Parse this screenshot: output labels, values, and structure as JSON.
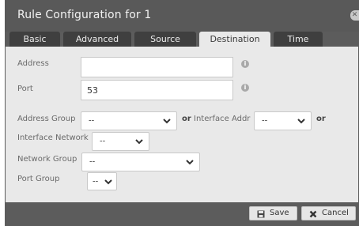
{
  "dialog": {
    "title": "Rule Configuration for 1",
    "close_icon": "close-icon"
  },
  "tabs": [
    {
      "label": "Basic",
      "active": false
    },
    {
      "label": "Advanced",
      "active": false
    },
    {
      "label": "Source",
      "active": false
    },
    {
      "label": "Destination",
      "active": true
    },
    {
      "label": "Time",
      "active": false
    }
  ],
  "form": {
    "address": {
      "label": "Address",
      "value": ""
    },
    "port": {
      "label": "Port",
      "value": "53"
    },
    "address_group": {
      "label": "Address Group",
      "value": "--"
    },
    "or_label": "or",
    "interface_addr": {
      "label": "Interface Addr",
      "value": "--"
    },
    "interface_network": {
      "label": "Interface Network",
      "value": "--"
    },
    "network_group": {
      "label": "Network Group",
      "value": "--"
    },
    "port_group": {
      "label": "Port Group",
      "value": "--"
    }
  },
  "footer": {
    "save_label": "Save",
    "cancel_label": "Cancel"
  },
  "colors": {
    "dialog_bg": "#5c5c5c",
    "panel_bg": "#e9e9e9",
    "tab_bg": "#3f3f3f",
    "tab_active_bg": "#e9e9e9"
  }
}
